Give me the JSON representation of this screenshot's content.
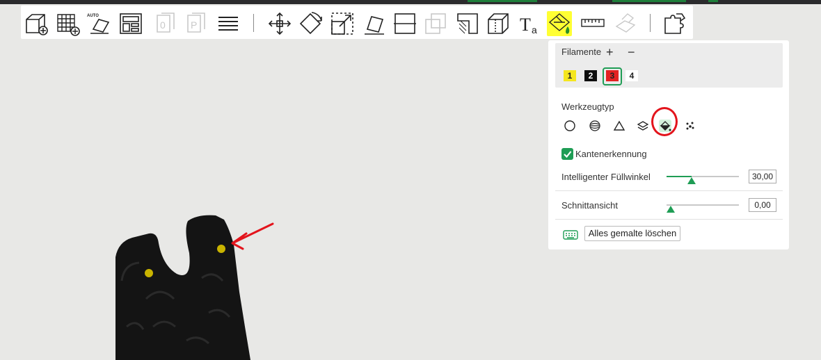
{
  "toolbar": {
    "tools": [
      {
        "icon": "add-cube-icon"
      },
      {
        "icon": "add-plate-icon"
      },
      {
        "icon": "auto-orient-icon",
        "badge": "AUTO"
      },
      {
        "icon": "arrange-icon"
      },
      {
        "icon": "object-copy-icon"
      },
      {
        "icon": "paste-icon"
      },
      {
        "icon": "layers-icon"
      },
      {
        "icon": "move-icon"
      },
      {
        "icon": "rotate-icon"
      },
      {
        "icon": "scale-icon"
      },
      {
        "icon": "lay-on-face-icon"
      },
      {
        "icon": "cut-icon"
      },
      {
        "icon": "boolean-icon"
      },
      {
        "icon": "support-paint-icon"
      },
      {
        "icon": "seam-paint-icon"
      },
      {
        "icon": "text-icon"
      },
      {
        "icon": "color-paint-icon",
        "active": true
      },
      {
        "icon": "measure-icon"
      },
      {
        "icon": "assembly-icon"
      },
      {
        "icon": "split-puzzle-icon"
      }
    ]
  },
  "panel": {
    "filaments_label": "Filamente",
    "add_symbol": "+",
    "remove_symbol": "−",
    "filaments": [
      {
        "number": "1",
        "color": "#f5e61e",
        "text_color": "#222222",
        "selected": false
      },
      {
        "number": "2",
        "color": "#0d0d0d",
        "text_color": "#ffffff",
        "selected": false
      },
      {
        "number": "3",
        "color": "#e32222",
        "text_color": "#222222",
        "selected": true
      },
      {
        "number": "4",
        "color": "#ffffff",
        "text_color": "#222222",
        "selected": false
      }
    ],
    "tool_type_label": "Werkzeugtyp",
    "tool_types": [
      {
        "icon": "circle-brush-icon",
        "selected": false
      },
      {
        "icon": "sphere-brush-icon",
        "selected": false
      },
      {
        "icon": "triangle-fill-icon",
        "selected": false
      },
      {
        "icon": "height-range-icon",
        "selected": false
      },
      {
        "icon": "fill-bucket-icon",
        "selected": true
      },
      {
        "icon": "gap-fill-icon",
        "selected": false
      }
    ],
    "edge_detection_label": "Kantenerkennung",
    "edge_detection_checked": true,
    "smart_fill_label": "Intelligenter Füllwinkel",
    "smart_fill_value": "30,00",
    "smart_fill_fraction": 0.35,
    "section_view_label": "Schnittansicht",
    "section_view_value": "0,00",
    "section_view_fraction": 0.0,
    "clear_button_label": "Alles gemalte löschen"
  },
  "colors": {
    "accent": "#1f9d55",
    "annotation": "#e3141c",
    "highlight": "#ffff33",
    "model": "#141414",
    "viewport": "#e8e8e6"
  }
}
